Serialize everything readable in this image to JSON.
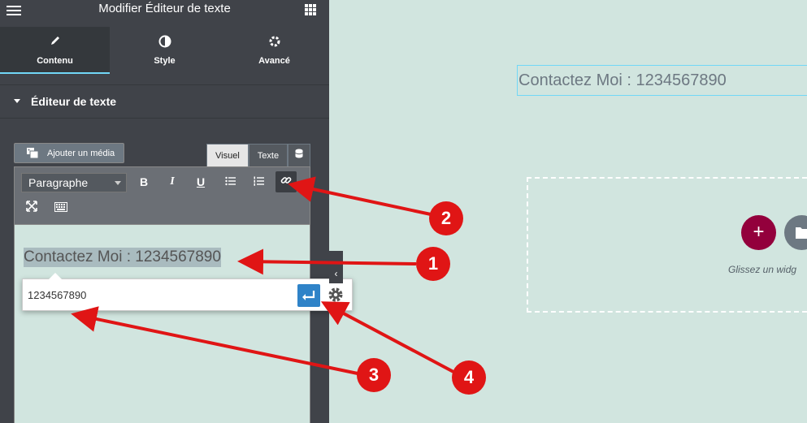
{
  "panel": {
    "title": "Modifier Éditeur de texte",
    "tabs": [
      {
        "label": "Contenu",
        "icon": "pencil-icon"
      },
      {
        "label": "Style",
        "icon": "half-circle-icon"
      },
      {
        "label": "Avancé",
        "icon": "gear-icon"
      }
    ],
    "section_title": "Éditeur de texte"
  },
  "editor": {
    "add_media": "Ajouter un média",
    "tabs": {
      "visual": "Visuel",
      "text": "Texte"
    },
    "format": "Paragraphe",
    "toolbar": {
      "bold": "B",
      "italic": "I",
      "underline": "U"
    },
    "content": "Contactez Moi : 1234567890",
    "link_value": "1234567890"
  },
  "preview": {
    "text": "Contactez Moi : 1234567890",
    "drop_hint": "Glissez un widg"
  },
  "annotations": [
    "1",
    "2",
    "3",
    "4"
  ],
  "colors": {
    "panel": "#404349",
    "canvas": "#d1e5df",
    "accent": "#71d7f7",
    "add_button": "#93003c",
    "annotation": "#e01515"
  }
}
